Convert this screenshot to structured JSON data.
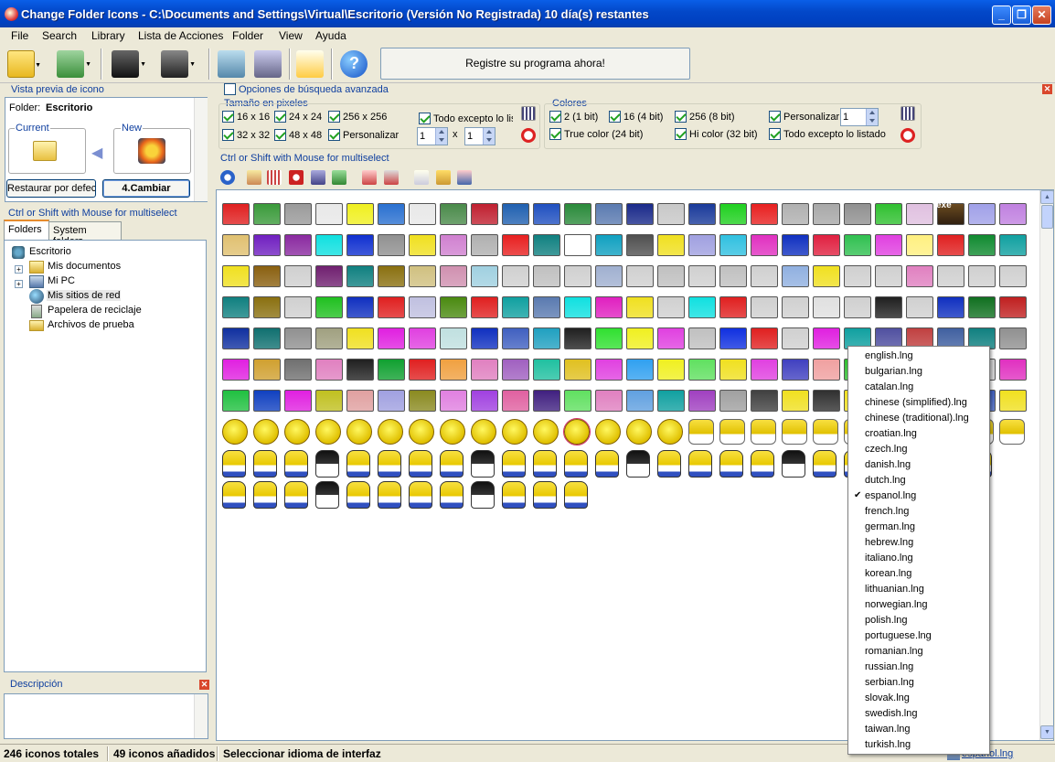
{
  "window": {
    "title": "Change Folder Icons - C:\\Documents and Settings\\Virtual\\Escritorio (Versión No Registrada) 10 día(s) restantes"
  },
  "menu": [
    "File",
    "Search",
    "Library",
    "Lista de Acciones",
    "Folder",
    "View",
    "Ayuda"
  ],
  "toolbar": {
    "register_label": "Registre su programa ahora!"
  },
  "preview": {
    "header": "Vista previa de icono",
    "folder_label": "Folder:",
    "folder_value": "Escritorio",
    "current_label": "Current",
    "new_label": "New",
    "restore_button": "Restaurar por defecto",
    "change_button": "4.Cambiar"
  },
  "left_hint": "Ctrl or Shift with Mouse for multiselect",
  "tabs": [
    "Folders",
    "System folders"
  ],
  "tree": [
    "Escritorio",
    "Mis documentos",
    "Mi PC",
    "Mis sitios de red",
    "Papelera de reciclaje",
    "Archivos de prueba"
  ],
  "description": {
    "header": "Descripción"
  },
  "search": {
    "advanced_label": "Opciones de búsqueda avanzada",
    "size_header": "Tamaño en pixeles",
    "sizes": [
      "16 x 16",
      "24 x 24",
      "256 x 256",
      "32 x 32",
      "48 x 48",
      "Personalizar"
    ],
    "except_label": "Todo excepto lo listado",
    "w_value": "1",
    "times": "x",
    "h_value": "1",
    "colors_header": "Colores",
    "colors": [
      "2 (1 bit)",
      "16 (4 bit)",
      "256 (8 bit)",
      "True color (24 bit)",
      "Hi color (32 bit)"
    ],
    "custom_label": "Personalizar",
    "custom_value": "1",
    "colors_except": "Todo excepto lo listado"
  },
  "grid_hint": "Ctrl or Shift with Mouse for multiselect",
  "languages": [
    "english.lng",
    "bulgarian.lng",
    "catalan.lng",
    "chinese (simplified).lng",
    "chinese (traditional).lng",
    "croatian.lng",
    "czech.lng",
    "danish.lng",
    "dutch.lng",
    "espanol.lng",
    "french.lng",
    "german.lng",
    "hebrew.lng",
    "italiano.lng",
    "korean.lng",
    "lithuanian.lng",
    "norwegian.lng",
    "polish.lng",
    "portuguese.lng",
    "romanian.lng",
    "russian.lng",
    "serbian.lng",
    "slovak.lng",
    "swedish.lng",
    "taiwan.lng",
    "turkish.lng"
  ],
  "selected_language": "espanol.lng",
  "status": {
    "total": "246 iconos totales",
    "added": "49 iconos añadidos",
    "message": "Seleccionar idioma de interfaz",
    "language": "espanol.lng"
  },
  "exe_label": "exe",
  "colors": {
    "title_blue": "#0348c9",
    "accent": "#0f3f9f"
  }
}
